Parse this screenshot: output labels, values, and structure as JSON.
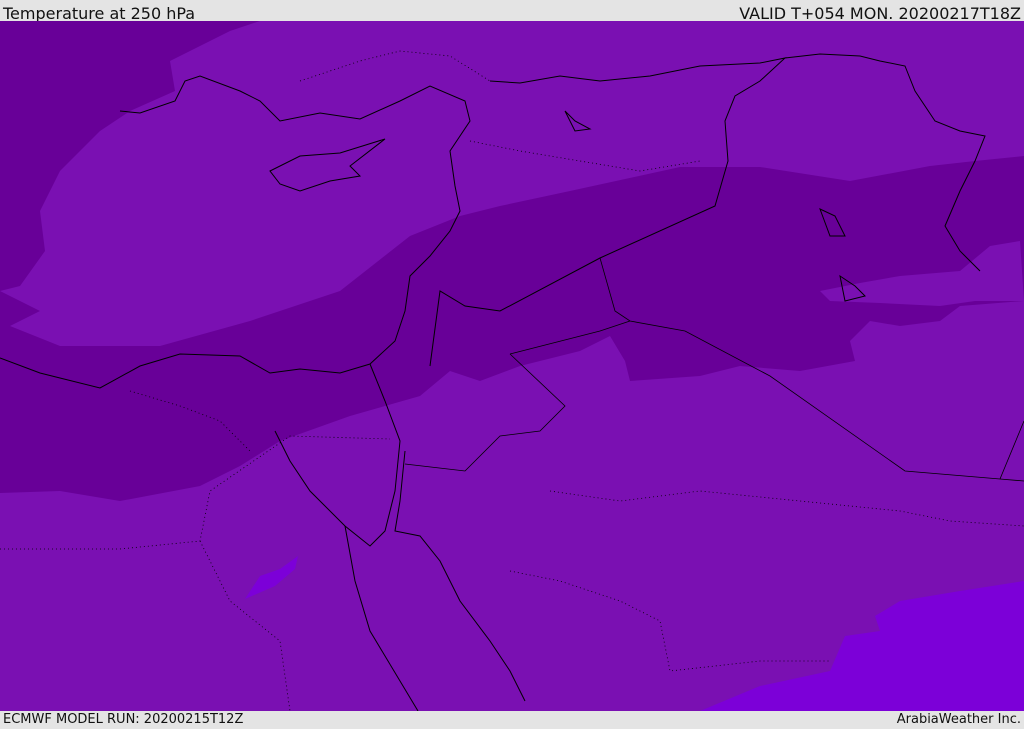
{
  "header": {
    "title": "Temperature at 250 hPa",
    "valid": "VALID T+054 MON. 20200217T18Z"
  },
  "footer": {
    "model_run": "ECMWF MODEL RUN: 20200215T12Z",
    "credit": "ArabiaWeather Inc."
  },
  "colors": {
    "base": "#7a10b2",
    "dark": "#680098",
    "bright": "#7c00d8",
    "coast": "#000000"
  }
}
